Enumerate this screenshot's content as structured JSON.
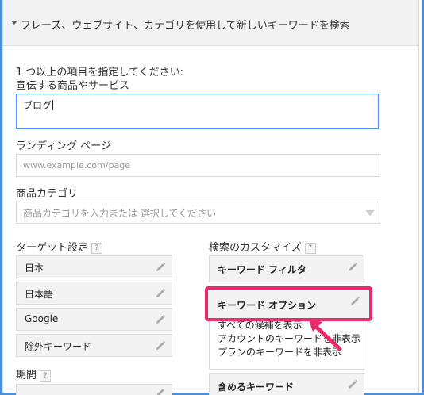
{
  "header": {
    "title": "フレーズ、ウェブサイト、カテゴリを使用して新しいキーワードを検索"
  },
  "form": {
    "instruction": "1 つ以上の項目を指定してください:",
    "product_label": "宣伝する商品やサービス",
    "product_value": "ブログ",
    "landing_label": "ランディング ページ",
    "landing_placeholder": "www.example.com/page",
    "category_label": "商品カテゴリ",
    "category_placeholder": "商品カテゴリを入力または 選択してください"
  },
  "targeting": {
    "label": "ターゲット設定",
    "help": "?",
    "items": [
      "日本",
      "日本語",
      "Google",
      "除外キーワード"
    ]
  },
  "period": {
    "label": "期間",
    "help": "?"
  },
  "customize": {
    "label": "検索のカスタマイズ",
    "help": "?",
    "keyword_filter": "キーワード フィルタ",
    "keyword_options": "キーワード オプション",
    "options_list": [
      "すべての候補を表示",
      "アカウントのキーワードを非表示",
      "プランのキーワードを非表示"
    ],
    "include_keywords": "含めるキーワード"
  },
  "colors": {
    "accent": "#ea2a6d",
    "focus": "#4d90fe",
    "frame": "#4a8fd8"
  },
  "icons": {
    "edit": "pencil-icon",
    "expand": "triangle-down-icon",
    "select": "chevron-down-icon"
  }
}
